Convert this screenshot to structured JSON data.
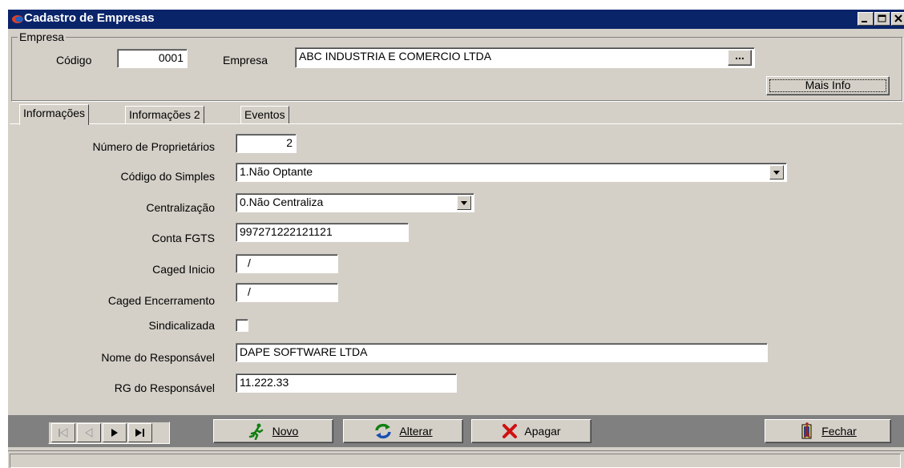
{
  "window": {
    "title": "Cadastro de Empresas"
  },
  "empresa_group": {
    "legend": "Empresa",
    "codigo_label": "Código",
    "codigo_value": "0001",
    "empresa_label": "Empresa",
    "empresa_value": "ABC INDUSTRIA E COMERCIO LTDA",
    "browse_label": "...",
    "mais_info_label": "Mais Info"
  },
  "tabs": [
    {
      "label": "Informações"
    },
    {
      "label": "Informações 2"
    },
    {
      "label": "Eventos"
    }
  ],
  "form": {
    "num_proprietarios_label": "Número de Proprietários",
    "num_proprietarios_value": "2",
    "codigo_simples_label": "Código do Simples",
    "codigo_simples_value": "1.Não Optante",
    "centralizacao_label": "Centralização",
    "centralizacao_value": "0.Não Centraliza",
    "conta_fgts_label": "Conta FGTS",
    "conta_fgts_value": "997271222121121",
    "caged_inicio_label": "Caged Inicio",
    "caged_inicio_value": "/",
    "caged_encerramento_label": "Caged Encerramento",
    "caged_encerramento_value": "/",
    "sindicalizada_label": "Sindicalizada",
    "nome_responsavel_label": "Nome do Responsável",
    "nome_responsavel_value": "DAPE SOFTWARE LTDA",
    "rg_responsavel_label": "RG do Responsável",
    "rg_responsavel_value": "11.222.33"
  },
  "toolbar": {
    "novo_label": "Novo",
    "alterar_label": "Alterar",
    "apagar_label": "Apagar",
    "fechar_label": "Fechar"
  },
  "colors": {
    "title_bar": "#0a246a",
    "face": "#d4d0c8",
    "nav_bar": "#808080"
  }
}
